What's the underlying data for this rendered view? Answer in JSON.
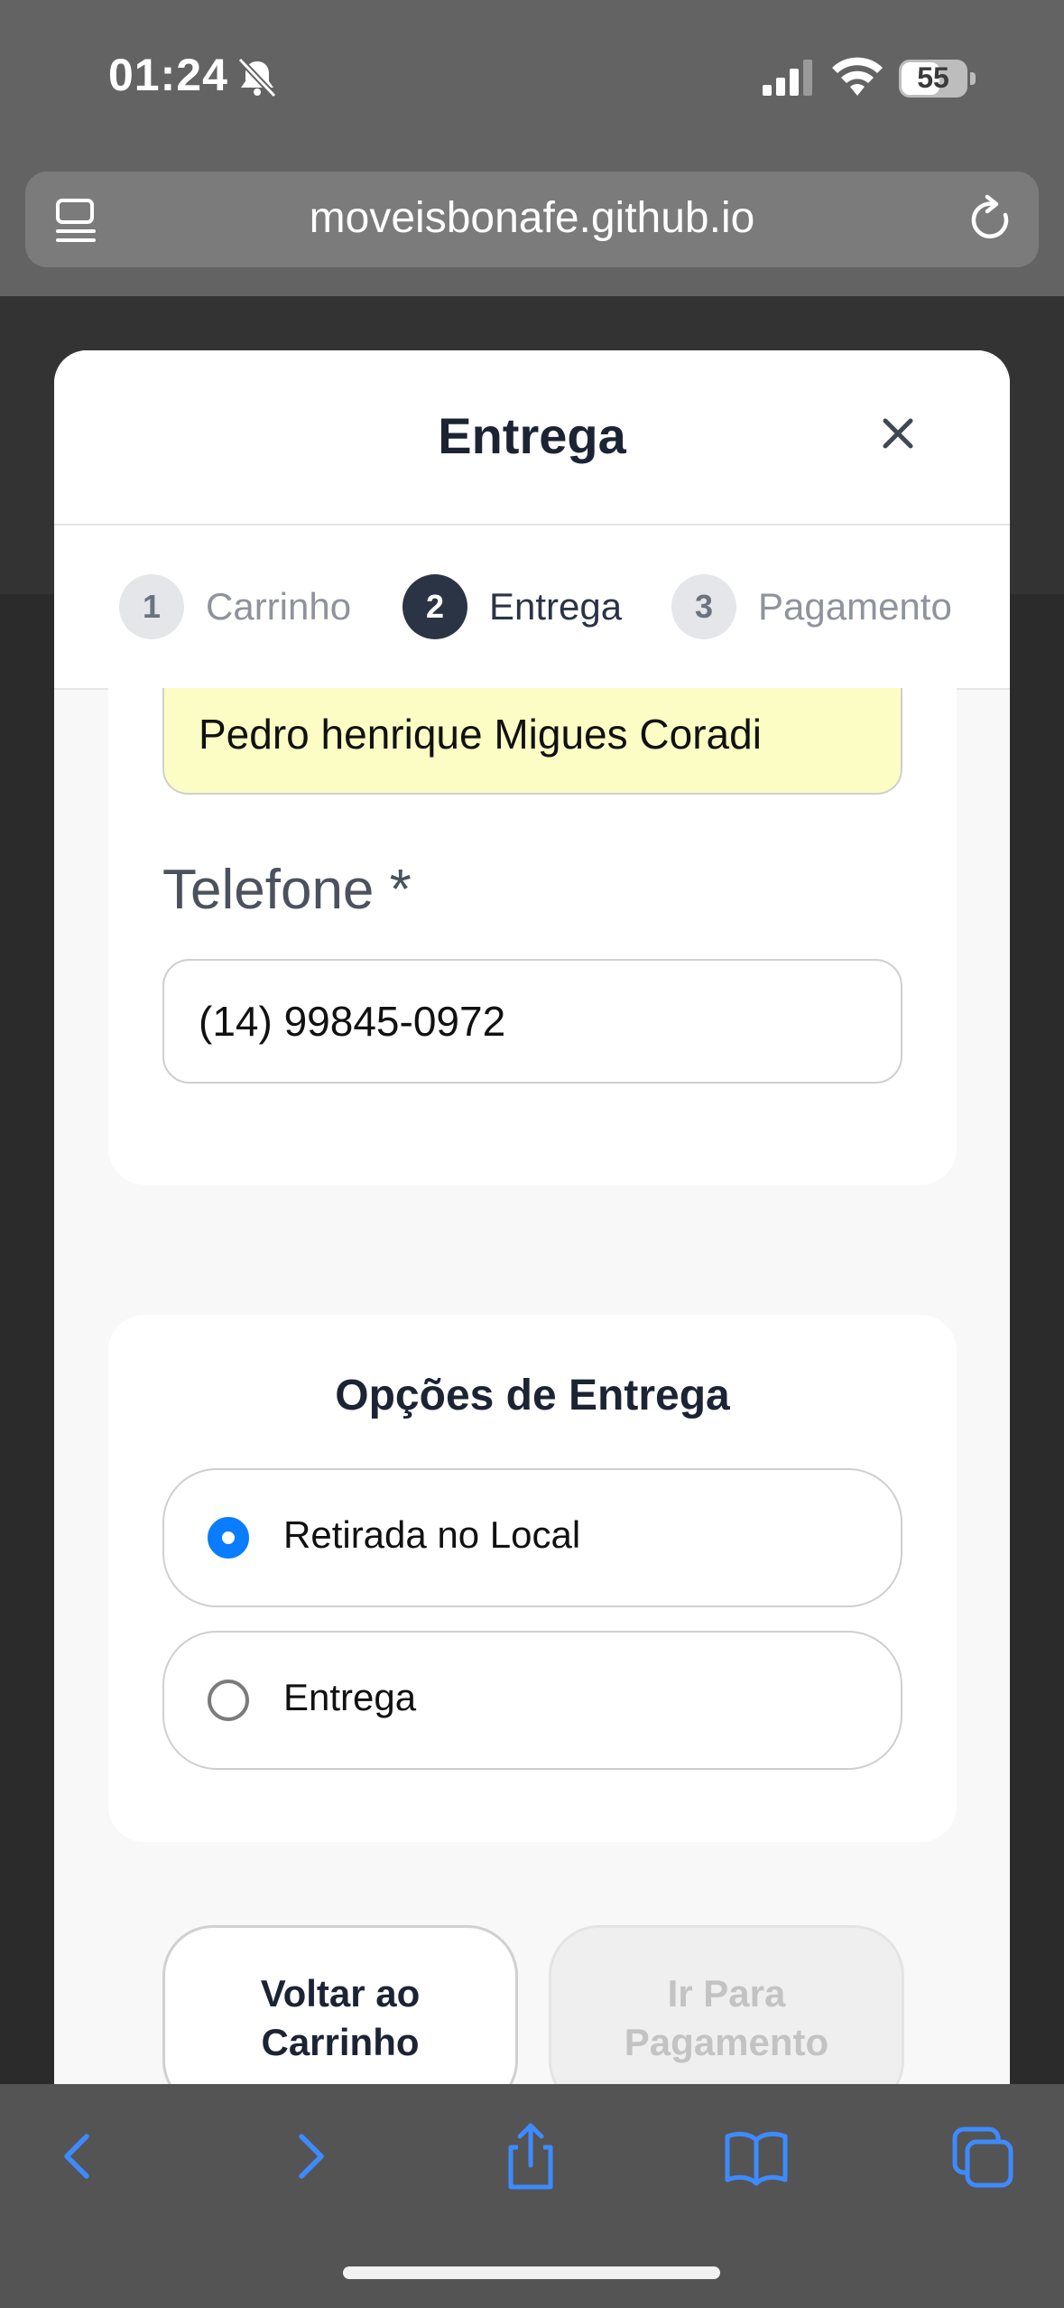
{
  "status_bar": {
    "time": "01:24",
    "battery": "55"
  },
  "browser": {
    "url": "moveisbonafe.github.io"
  },
  "modal": {
    "title": "Entrega",
    "steps": [
      {
        "number": "1",
        "label": "Carrinho"
      },
      {
        "number": "2",
        "label": "Entrega"
      },
      {
        "number": "3",
        "label": "Pagamento"
      }
    ],
    "name_value": "Pedro henrique Migues Coradi",
    "phone_label": "Telefone *",
    "phone_value": "(14) 99845-0972",
    "delivery_options": {
      "title": "Opções de Entrega",
      "options": [
        {
          "label": "Retirada no Local",
          "selected": true
        },
        {
          "label": "Entrega",
          "selected": false
        }
      ]
    },
    "back_button": {
      "line1": "Voltar ao",
      "line2": "Carrinho"
    },
    "pay_button": {
      "line1": "Ir Para",
      "line2": "Pagamento"
    }
  },
  "colors": {
    "accent": "#0a7cff",
    "dark": "#1c2434",
    "muted": "#8e939c",
    "autofill": "#fbfdc4"
  },
  "toolbar_icons": [
    "back-icon",
    "forward-icon",
    "share-icon",
    "bookmarks-icon",
    "tabs-icon"
  ]
}
